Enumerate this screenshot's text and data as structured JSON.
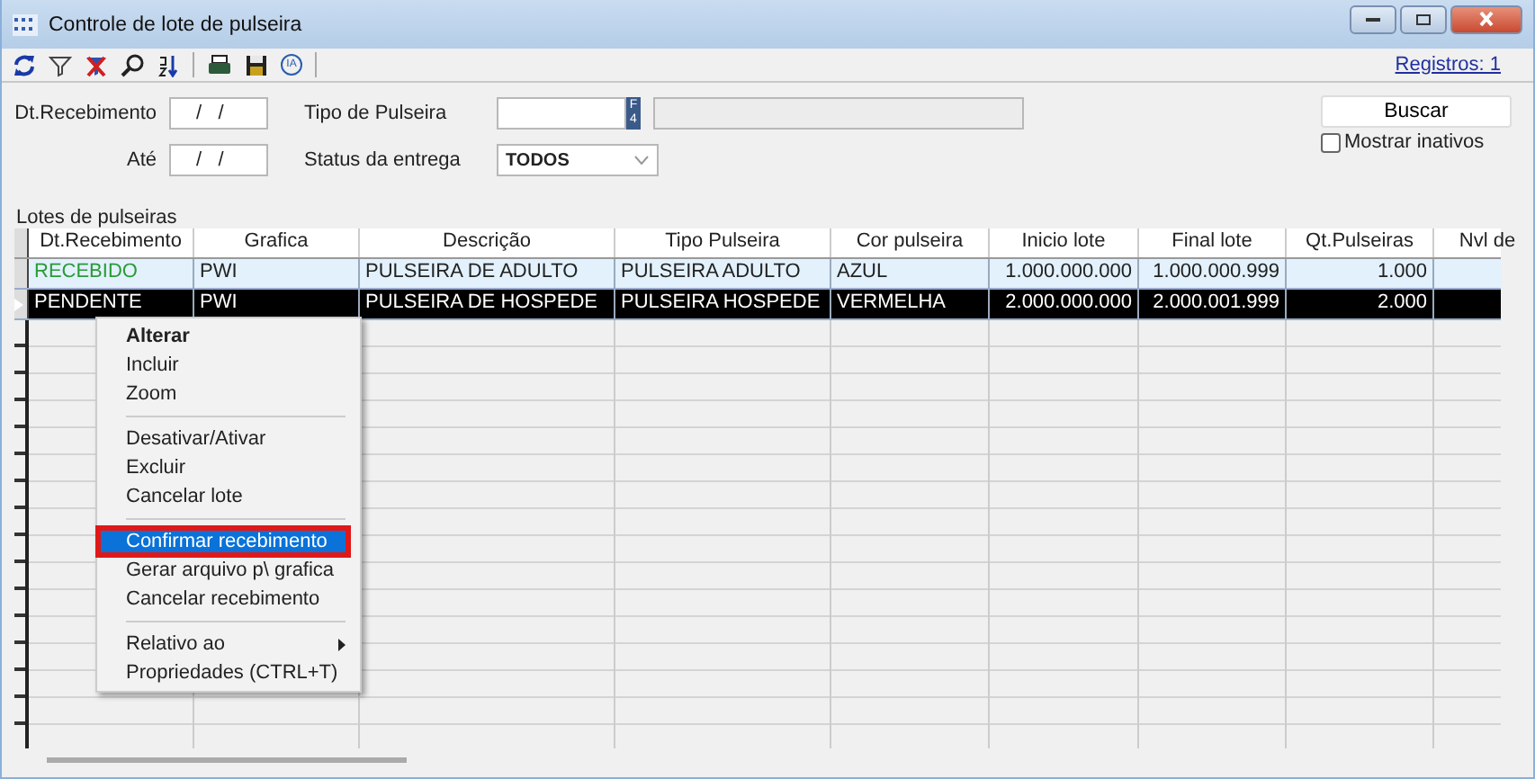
{
  "window": {
    "title": "Controle de lote de pulseira"
  },
  "toolbar": {
    "records_link": "Registros: 1",
    "badge": "IA"
  },
  "form": {
    "date_from": {
      "label": "Dt.Recebimento",
      "value": "/   /"
    },
    "date_to": {
      "label": "Até",
      "value": "/   /"
    },
    "type": {
      "label": "Tipo de Pulseira",
      "key_button": "F4"
    },
    "status": {
      "label": "Status da entrega",
      "value": "TODOS"
    },
    "search_button": "Buscar",
    "show_inactive": {
      "label": "Mostrar inativos",
      "checked": false
    }
  },
  "grid": {
    "title": "Lotes de pulseiras",
    "columns": [
      "Dt.Recebimento",
      "Grafica",
      "Descrição",
      "Tipo Pulseira",
      "Cor pulseira",
      "Inicio lote",
      "Final lote",
      "Qt.Pulseiras",
      "Nvl de"
    ],
    "rows": [
      {
        "selected": false,
        "color": "#2a9a36",
        "cells": [
          "RECEBIDO",
          "PWI",
          "PULSEIRA DE ADULTO",
          "PULSEIRA ADULTO",
          "AZUL",
          "1.000.000.000",
          "1.000.000.999",
          "1.000",
          ""
        ]
      },
      {
        "selected": true,
        "cells": [
          "PENDENTE",
          "PWI",
          "PULSEIRA DE HOSPEDE",
          "PULSEIRA HOSPEDE",
          "VERMELHA",
          "2.000.000.000",
          "2.000.001.999",
          "2.000",
          ""
        ]
      }
    ]
  },
  "context_menu": [
    {
      "kind": "item",
      "label": "Alterar",
      "bold": true,
      "selected": false
    },
    {
      "kind": "item",
      "label": "Incluir",
      "bold": false,
      "selected": false
    },
    {
      "kind": "item",
      "label": "Zoom",
      "bold": false,
      "selected": false
    },
    {
      "kind": "separator"
    },
    {
      "kind": "item",
      "label": "Desativar/Ativar",
      "bold": false,
      "selected": false
    },
    {
      "kind": "item",
      "label": "Excluir",
      "bold": false,
      "selected": false
    },
    {
      "kind": "item",
      "label": "Cancelar lote",
      "bold": false,
      "selected": false
    },
    {
      "kind": "separator"
    },
    {
      "kind": "item",
      "label": "Confirmar recebimento",
      "bold": false,
      "selected": true
    },
    {
      "kind": "item",
      "label": "Gerar arquivo p\\ grafica",
      "bold": false,
      "selected": false
    },
    {
      "kind": "item",
      "label": "Cancelar recebimento",
      "bold": false,
      "selected": false
    },
    {
      "kind": "separator"
    },
    {
      "kind": "submenu",
      "label": "Relativo ao",
      "bold": false,
      "selected": false
    },
    {
      "kind": "item",
      "label": "Propriedades (CTRL+T)",
      "bold": false,
      "selected": false
    }
  ]
}
